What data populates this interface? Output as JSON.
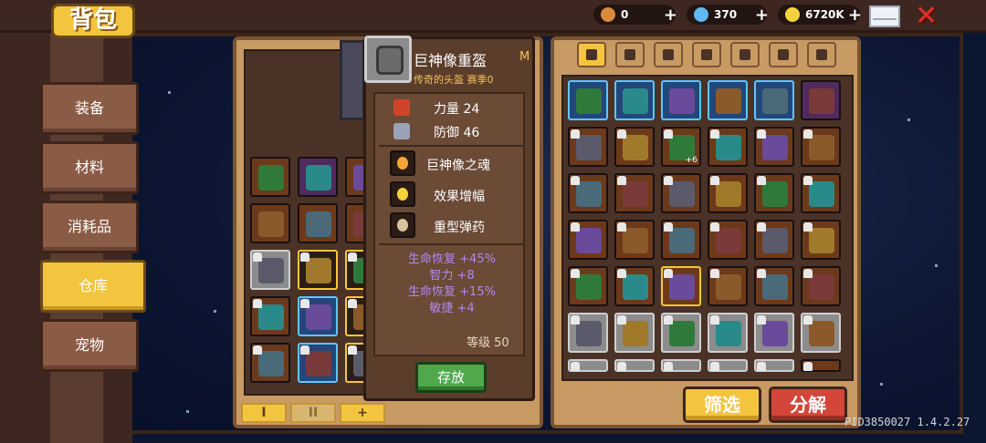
{
  "header": {
    "title": "背包",
    "resources": [
      {
        "name": "gold-egg",
        "value": "0",
        "color": "#d98a3a"
      },
      {
        "name": "gem",
        "value": "370",
        "color": "#5fb8f0"
      },
      {
        "name": "coin",
        "value": "6720K",
        "color": "#f6d23a"
      }
    ],
    "plus": "+"
  },
  "sidebar": {
    "items": [
      {
        "label": "装备"
      },
      {
        "label": "材料"
      },
      {
        "label": "消耗品"
      },
      {
        "label": "仓库",
        "active": true
      },
      {
        "label": "宠物"
      }
    ]
  },
  "tooltip": {
    "name": "巨神像重盔",
    "grade": "M",
    "subtitle": "传奇的头盔 赛季0",
    "stats": [
      {
        "label": "力量 24",
        "icon": "fist-icon",
        "color": "#d0442a"
      },
      {
        "label": "防御 46",
        "icon": "shield-icon",
        "color": "#9aa3b5"
      }
    ],
    "skills": [
      {
        "label": "巨神像之魂",
        "icon": "flame-icon",
        "color": "#f6a536"
      },
      {
        "label": "效果增幅",
        "icon": "sparkle-icon",
        "color": "#f6d23a"
      },
      {
        "label": "重型弹药",
        "icon": "bullet-icon",
        "color": "#d8c49a"
      }
    ],
    "bonuses": [
      "生命恢复 +45%",
      "智力 +8",
      "生命恢复 +15%",
      "敏捷 +4"
    ],
    "level": "等级 50",
    "store_button": "存放"
  },
  "bag_pages": [
    "I",
    "II",
    "+"
  ],
  "filter_tabs": [
    "grid-icon",
    "sword-icon",
    "armor-icon",
    "helmet-icon",
    "boots-icon",
    "ring-icon",
    "amulet-icon"
  ],
  "buttons": {
    "filter": "筛选",
    "decompose": "分解"
  },
  "warehouse": {
    "rows": [
      [
        "blue",
        "blue",
        "blue",
        "blue",
        "blue",
        "purple"
      ],
      [
        "gold",
        "gold",
        "gold",
        "gold",
        "gold",
        "gold"
      ],
      [
        "gold",
        "gold",
        "gold",
        "gold",
        "gold",
        "gold"
      ],
      [
        "gold",
        "gold",
        "gold",
        "gold",
        "gold",
        "gold"
      ],
      [
        "gold",
        "gold",
        "gold",
        "gold",
        "gold",
        "gold"
      ],
      [
        "gray",
        "gray",
        "gray",
        "gray",
        "gray",
        "gray"
      ]
    ],
    "stack_label": "+6"
  },
  "footer": {
    "pid": "PID3850027 1.4.2.27"
  }
}
